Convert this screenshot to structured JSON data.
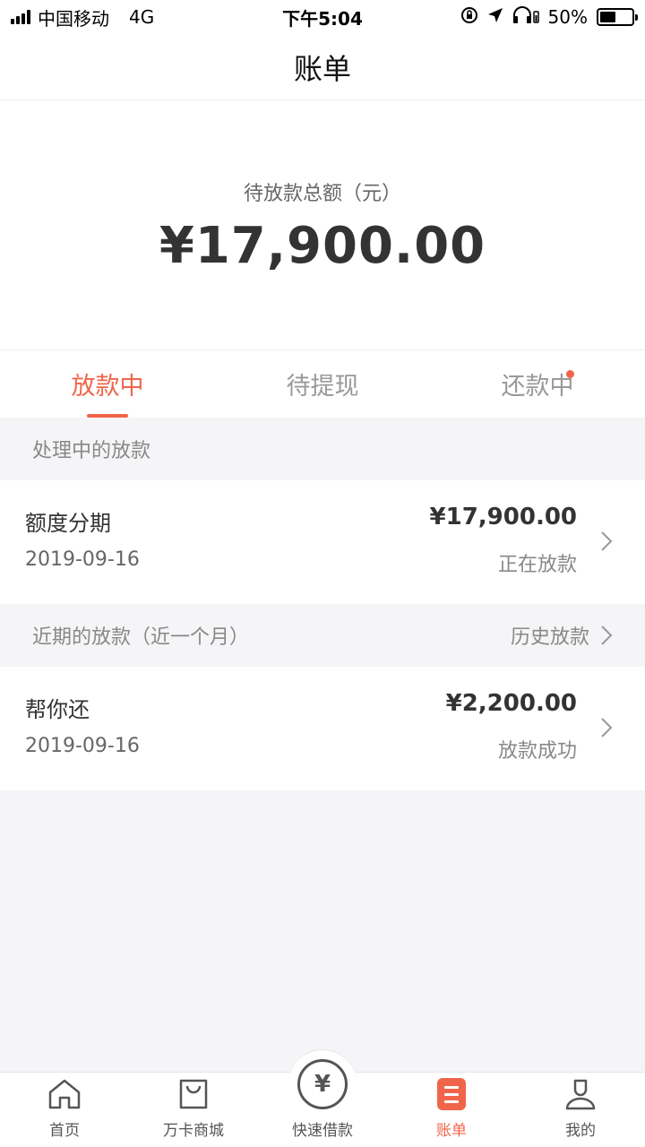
{
  "status_bar": {
    "carrier": "中国移动",
    "network": "4G",
    "time": "下午5:04",
    "battery_text": "50%",
    "battery_level": 0.5
  },
  "nav": {
    "title": "账单"
  },
  "summary": {
    "label": "待放款总额（元）",
    "amount": "¥17,900.00"
  },
  "tabs": [
    {
      "label": "放款中",
      "active": true
    },
    {
      "label": "待提现",
      "active": false
    },
    {
      "label": "还款中",
      "active": false,
      "badge": true
    }
  ],
  "processing": {
    "header": "处理中的放款",
    "records": [
      {
        "name": "额度分期",
        "date": "2019-09-16",
        "amount": "¥17,900.00",
        "status": "正在放款"
      }
    ]
  },
  "recent": {
    "header": "近期的放款（近一个月）",
    "history_link": "历史放款",
    "records": [
      {
        "name": "帮你还",
        "date": "2019-09-16",
        "amount": "¥2,200.00",
        "status": "放款成功"
      }
    ]
  },
  "tabbar": [
    {
      "label": "首页",
      "icon": "home-icon"
    },
    {
      "label": "万卡商城",
      "icon": "shopping-bag-icon"
    },
    {
      "label": "快速借款",
      "icon": "yen-circle-icon",
      "symbol": "¥"
    },
    {
      "label": "账单",
      "icon": "bill-icon",
      "active": true
    },
    {
      "label": "我的",
      "icon": "user-icon"
    }
  ],
  "colors": {
    "accent": "#f0654a",
    "text": "#333333",
    "muted": "#888888",
    "background": "#f5f5f7"
  }
}
